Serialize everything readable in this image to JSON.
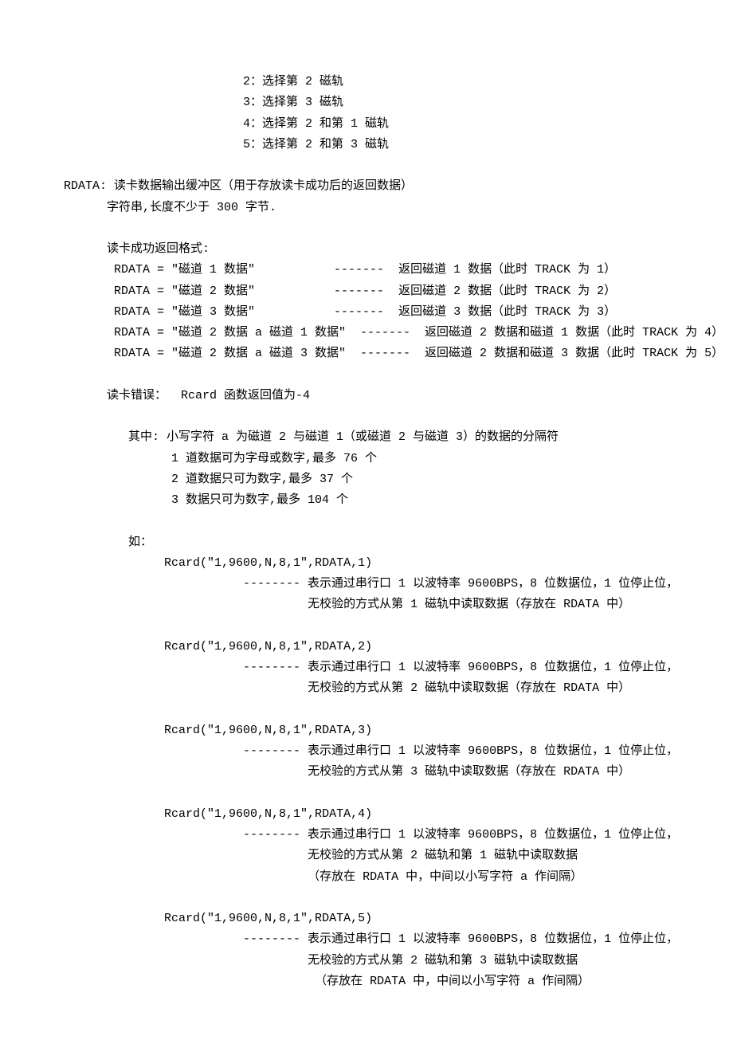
{
  "track_opts": {
    "l1": "2：选择第 2 磁轨",
    "l2": "3：选择第 3 磁轨",
    "l3": "4：选择第 2 和第 1 磁轨",
    "l4": "5：选择第 2 和第 3 磁轨"
  },
  "rdata_desc": {
    "l1": "RDATA: 读卡数据输出缓冲区（用于存放读卡成功后的返回数据）",
    "l2": "字符串,长度不少于 300 字节."
  },
  "success_header": "读卡成功返回格式:",
  "success": {
    "l1": "RDATA = \"磁道 1 数据\"           -------  返回磁道 1 数据（此时 TRACK 为 1）",
    "l2": "RDATA = \"磁道 2 数据\"           -------  返回磁道 2 数据（此时 TRACK 为 2）",
    "l3": "RDATA = \"磁道 3 数据\"           -------  返回磁道 3 数据（此时 TRACK 为 3）",
    "l4": "RDATA = \"磁道 2 数据 a 磁道 1 数据\"  -------  返回磁道 2 数据和磁道 1 数据（此时 TRACK 为 4）",
    "l5": "RDATA = \"磁道 2 数据 a 磁道 3 数据\"  -------  返回磁道 2 数据和磁道 3 数据（此时 TRACK 为 5）"
  },
  "err_line": "读卡错误：  Rcard 函数返回值为-4",
  "note": {
    "l1": "其中: 小写字符 a 为磁道 2 与磁道 1（或磁道 2 与磁道 3）的数据的分隔符",
    "l2": "1 道数据可为字母或数字,最多 76 个",
    "l3": "2 道数据只可为数字,最多 37 个",
    "l4": "3 数据只可为数字,最多 104 个"
  },
  "ex_header": "如：",
  "ex1": {
    "call": "Rcard(\"1,9600,N,8,1\",RDATA,1)",
    "d1": "-------- 表示通过串行口 1 以波特率 9600BPS，8 位数据位，1 位停止位，",
    "d2": "无校验的方式从第 1 磁轨中读取数据（存放在 RDATA 中）"
  },
  "ex2": {
    "call": "Rcard(\"1,9600,N,8,1\",RDATA,2)",
    "d1": "-------- 表示通过串行口 1 以波特率 9600BPS，8 位数据位，1 位停止位，",
    "d2": "无校验的方式从第 2 磁轨中读取数据（存放在 RDATA 中）"
  },
  "ex3": {
    "call": "Rcard(\"1,9600,N,8,1\",RDATA,3)",
    "d1": "-------- 表示通过串行口 1 以波特率 9600BPS，8 位数据位，1 位停止位，",
    "d2": "无校验的方式从第 3 磁轨中读取数据（存放在 RDATA 中）"
  },
  "ex4": {
    "call": "Rcard(\"1,9600,N,8,1\",RDATA,4)",
    "d1": "-------- 表示通过串行口 1 以波特率 9600BPS，8 位数据位，1 位停止位，",
    "d2": "无校验的方式从第 2 磁轨和第 1 磁轨中读取数据",
    "d3": "（存放在 RDATA 中，中间以小写字符 a 作间隔）"
  },
  "ex5": {
    "call": "Rcard(\"1,9600,N,8,1\",RDATA,5)",
    "d1": "-------- 表示通过串行口 1 以波特率 9600BPS，8 位数据位，1 位停止位，",
    "d2": "无校验的方式从第 2 磁轨和第 3 磁轨中读取数据",
    "d3": "（存放在 RDATA 中，中间以小写字符 a 作间隔）"
  }
}
